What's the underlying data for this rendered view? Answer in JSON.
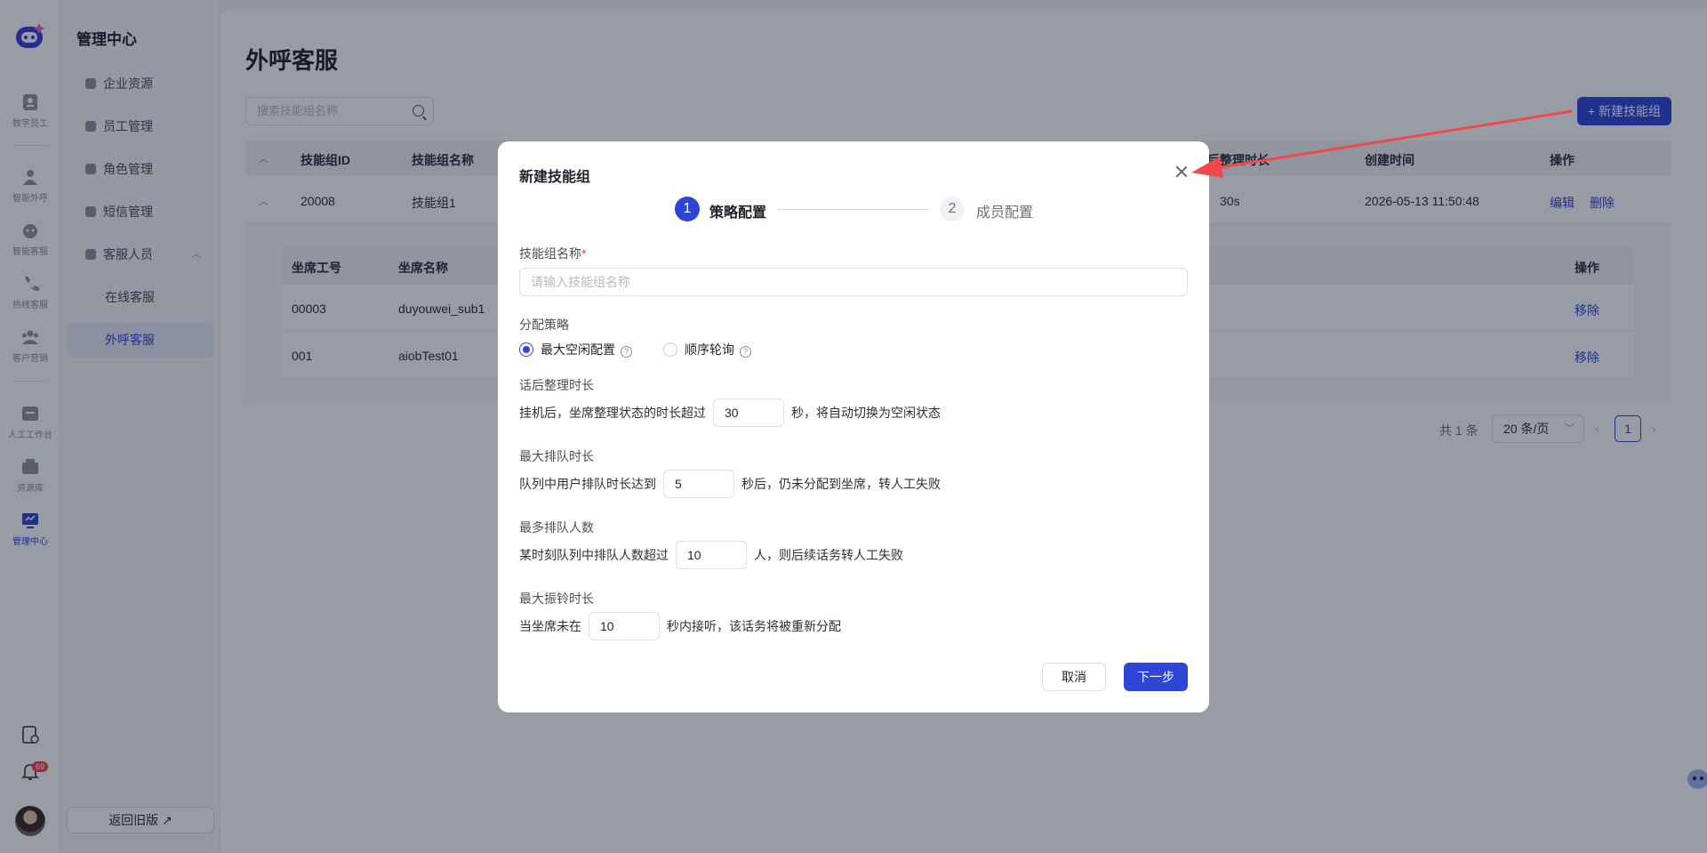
{
  "rail": {
    "items": [
      {
        "label": "数字员工",
        "icon": "digital-employee-icon"
      },
      {
        "label": "智能外呼",
        "icon": "outbound-call-icon"
      },
      {
        "label": "智能客服",
        "icon": "smart-service-icon"
      },
      {
        "label": "热线客服",
        "icon": "hotline-icon"
      },
      {
        "label": "客户营销",
        "icon": "marketing-icon"
      },
      {
        "label": "人工工作台",
        "icon": "workbench-icon"
      },
      {
        "label": "资源库",
        "icon": "resource-icon"
      },
      {
        "label": "管理中心",
        "icon": "admin-icon"
      }
    ],
    "notification_count": "69"
  },
  "nav": {
    "title": "管理中心",
    "items": [
      {
        "label": "企业资源"
      },
      {
        "label": "员工管理"
      },
      {
        "label": "角色管理"
      },
      {
        "label": "短信管理"
      },
      {
        "label": "客服人员"
      },
      {
        "label": "在线客服"
      },
      {
        "label": "外呼客服"
      }
    ],
    "back_label": "返回旧版 ↗"
  },
  "main": {
    "title": "外呼客服",
    "search_placeholder": "搜索技能组名称",
    "new_button": "+ 新建技能组",
    "table": {
      "headers": [
        "技能组ID",
        "技能组名称",
        "话后整理时长",
        "创建时间",
        "操作"
      ],
      "row": {
        "id": "20008",
        "name": "技能组1",
        "wrapup": "30s",
        "created": "2026-05-13 11:50:48",
        "edit": "编辑",
        "delete": "删除"
      }
    },
    "subtable": {
      "headers": [
        "坐席工号",
        "坐席名称",
        "操作"
      ],
      "rows": [
        {
          "code": "00003",
          "name": "duyouwei_sub1",
          "action": "移除"
        },
        {
          "code": "001",
          "name": "aiobTest01",
          "action": "移除"
        }
      ]
    },
    "pager": {
      "total": "共 1 条",
      "size": "20 条/页",
      "current": "1"
    }
  },
  "modal": {
    "title": "新建技能组",
    "steps": [
      {
        "num": "1",
        "label": "策略配置"
      },
      {
        "num": "2",
        "label": "成员配置"
      }
    ],
    "name_label": "技能组名称",
    "name_required": "*",
    "name_placeholder": "请输入技能组名称",
    "strategy_label": "分配策略",
    "strategy_options": [
      "最大空闲配置",
      "顺序轮询"
    ],
    "strategy_selected": "最大空闲配置",
    "wrapup": {
      "label": "话后整理时长",
      "before": "挂机后，坐席整理状态的时长超过",
      "value": "30",
      "after": "秒，将自动切换为空闲状态"
    },
    "queue_time": {
      "label": "最大排队时长",
      "before": "队列中用户排队时长达到",
      "value": "5",
      "after": "秒后，仍未分配到坐席，转人工失败"
    },
    "queue_count": {
      "label": "最多排队人数",
      "before": "某时刻队列中排队人数超过",
      "value": "10",
      "after": "人，则后续话务转人工失败"
    },
    "ring_time": {
      "label": "最大振铃时长",
      "before": "当坐席未在",
      "value": "10",
      "after": "秒内接听，该话务将被重新分配"
    },
    "cancel": "取消",
    "next": "下一步"
  },
  "colors": {
    "primary": "#2f45d8",
    "danger": "#f5484c",
    "annotation_arrow": "#f0484c"
  }
}
